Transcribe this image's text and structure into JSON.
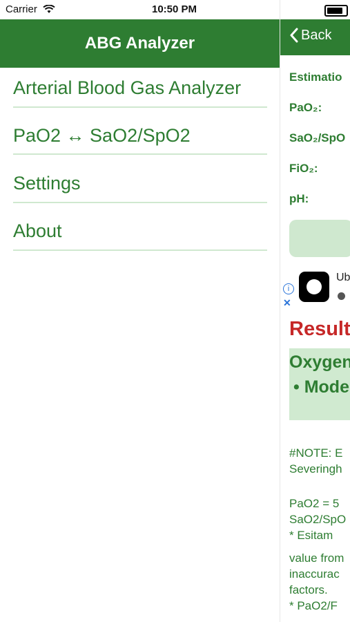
{
  "status_bar": {
    "carrier": "Carrier",
    "time": "10:50 PM"
  },
  "menu": {
    "title": "ABG Analyzer",
    "items": [
      {
        "label": "Arterial Blood Gas Analyzer"
      },
      {
        "label": "PaO2 ↔ SaO2/SpO2"
      },
      {
        "label": "Settings"
      },
      {
        "label": "About"
      }
    ]
  },
  "detail": {
    "back_label": "Back",
    "estimation_label": "Estimatio",
    "fields": [
      {
        "label": "PaO₂:"
      },
      {
        "label": "SaO₂/SpO"
      },
      {
        "label": "FiO₂:"
      },
      {
        "label": "pH:"
      }
    ],
    "ad": {
      "title": "Ub"
    },
    "results": {
      "title": "Result",
      "line1": "Oxygen",
      "line2": "• Mode"
    },
    "notes": [
      "#NOTE: E",
      "Severingh",
      "",
      "PaO2  = 5",
      "SaO2/SpO",
      "  * Esitam",
      "value from",
      "inaccurac",
      "factors.",
      "  * PaO2/F"
    ]
  },
  "colors": {
    "brand_green": "#2e7d32",
    "light_green": "#cfe8cf",
    "results_red": "#c62828"
  },
  "icons": [
    "wifi-icon",
    "battery-icon",
    "back-chevron-icon",
    "ad-info-icon",
    "ad-close-icon",
    "ad-app-icon",
    "apple-icon"
  ]
}
